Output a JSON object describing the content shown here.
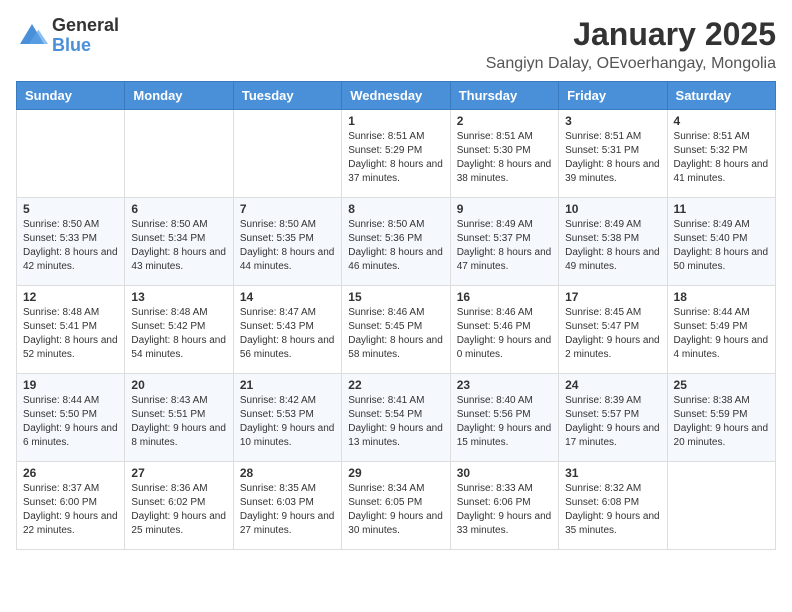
{
  "header": {
    "logo_general": "General",
    "logo_blue": "Blue",
    "calendar_title": "January 2025",
    "calendar_subtitle": "Sangiyn Dalay, OEvoerhangay, Mongolia"
  },
  "weekdays": [
    "Sunday",
    "Monday",
    "Tuesday",
    "Wednesday",
    "Thursday",
    "Friday",
    "Saturday"
  ],
  "weeks": [
    [
      {
        "day": "",
        "info": ""
      },
      {
        "day": "",
        "info": ""
      },
      {
        "day": "",
        "info": ""
      },
      {
        "day": "1",
        "info": "Sunrise: 8:51 AM\nSunset: 5:29 PM\nDaylight: 8 hours and 37 minutes."
      },
      {
        "day": "2",
        "info": "Sunrise: 8:51 AM\nSunset: 5:30 PM\nDaylight: 8 hours and 38 minutes."
      },
      {
        "day": "3",
        "info": "Sunrise: 8:51 AM\nSunset: 5:31 PM\nDaylight: 8 hours and 39 minutes."
      },
      {
        "day": "4",
        "info": "Sunrise: 8:51 AM\nSunset: 5:32 PM\nDaylight: 8 hours and 41 minutes."
      }
    ],
    [
      {
        "day": "5",
        "info": "Sunrise: 8:50 AM\nSunset: 5:33 PM\nDaylight: 8 hours and 42 minutes."
      },
      {
        "day": "6",
        "info": "Sunrise: 8:50 AM\nSunset: 5:34 PM\nDaylight: 8 hours and 43 minutes."
      },
      {
        "day": "7",
        "info": "Sunrise: 8:50 AM\nSunset: 5:35 PM\nDaylight: 8 hours and 44 minutes."
      },
      {
        "day": "8",
        "info": "Sunrise: 8:50 AM\nSunset: 5:36 PM\nDaylight: 8 hours and 46 minutes."
      },
      {
        "day": "9",
        "info": "Sunrise: 8:49 AM\nSunset: 5:37 PM\nDaylight: 8 hours and 47 minutes."
      },
      {
        "day": "10",
        "info": "Sunrise: 8:49 AM\nSunset: 5:38 PM\nDaylight: 8 hours and 49 minutes."
      },
      {
        "day": "11",
        "info": "Sunrise: 8:49 AM\nSunset: 5:40 PM\nDaylight: 8 hours and 50 minutes."
      }
    ],
    [
      {
        "day": "12",
        "info": "Sunrise: 8:48 AM\nSunset: 5:41 PM\nDaylight: 8 hours and 52 minutes."
      },
      {
        "day": "13",
        "info": "Sunrise: 8:48 AM\nSunset: 5:42 PM\nDaylight: 8 hours and 54 minutes."
      },
      {
        "day": "14",
        "info": "Sunrise: 8:47 AM\nSunset: 5:43 PM\nDaylight: 8 hours and 56 minutes."
      },
      {
        "day": "15",
        "info": "Sunrise: 8:46 AM\nSunset: 5:45 PM\nDaylight: 8 hours and 58 minutes."
      },
      {
        "day": "16",
        "info": "Sunrise: 8:46 AM\nSunset: 5:46 PM\nDaylight: 9 hours and 0 minutes."
      },
      {
        "day": "17",
        "info": "Sunrise: 8:45 AM\nSunset: 5:47 PM\nDaylight: 9 hours and 2 minutes."
      },
      {
        "day": "18",
        "info": "Sunrise: 8:44 AM\nSunset: 5:49 PM\nDaylight: 9 hours and 4 minutes."
      }
    ],
    [
      {
        "day": "19",
        "info": "Sunrise: 8:44 AM\nSunset: 5:50 PM\nDaylight: 9 hours and 6 minutes."
      },
      {
        "day": "20",
        "info": "Sunrise: 8:43 AM\nSunset: 5:51 PM\nDaylight: 9 hours and 8 minutes."
      },
      {
        "day": "21",
        "info": "Sunrise: 8:42 AM\nSunset: 5:53 PM\nDaylight: 9 hours and 10 minutes."
      },
      {
        "day": "22",
        "info": "Sunrise: 8:41 AM\nSunset: 5:54 PM\nDaylight: 9 hours and 13 minutes."
      },
      {
        "day": "23",
        "info": "Sunrise: 8:40 AM\nSunset: 5:56 PM\nDaylight: 9 hours and 15 minutes."
      },
      {
        "day": "24",
        "info": "Sunrise: 8:39 AM\nSunset: 5:57 PM\nDaylight: 9 hours and 17 minutes."
      },
      {
        "day": "25",
        "info": "Sunrise: 8:38 AM\nSunset: 5:59 PM\nDaylight: 9 hours and 20 minutes."
      }
    ],
    [
      {
        "day": "26",
        "info": "Sunrise: 8:37 AM\nSunset: 6:00 PM\nDaylight: 9 hours and 22 minutes."
      },
      {
        "day": "27",
        "info": "Sunrise: 8:36 AM\nSunset: 6:02 PM\nDaylight: 9 hours and 25 minutes."
      },
      {
        "day": "28",
        "info": "Sunrise: 8:35 AM\nSunset: 6:03 PM\nDaylight: 9 hours and 27 minutes."
      },
      {
        "day": "29",
        "info": "Sunrise: 8:34 AM\nSunset: 6:05 PM\nDaylight: 9 hours and 30 minutes."
      },
      {
        "day": "30",
        "info": "Sunrise: 8:33 AM\nSunset: 6:06 PM\nDaylight: 9 hours and 33 minutes."
      },
      {
        "day": "31",
        "info": "Sunrise: 8:32 AM\nSunset: 6:08 PM\nDaylight: 9 hours and 35 minutes."
      },
      {
        "day": "",
        "info": ""
      }
    ]
  ]
}
